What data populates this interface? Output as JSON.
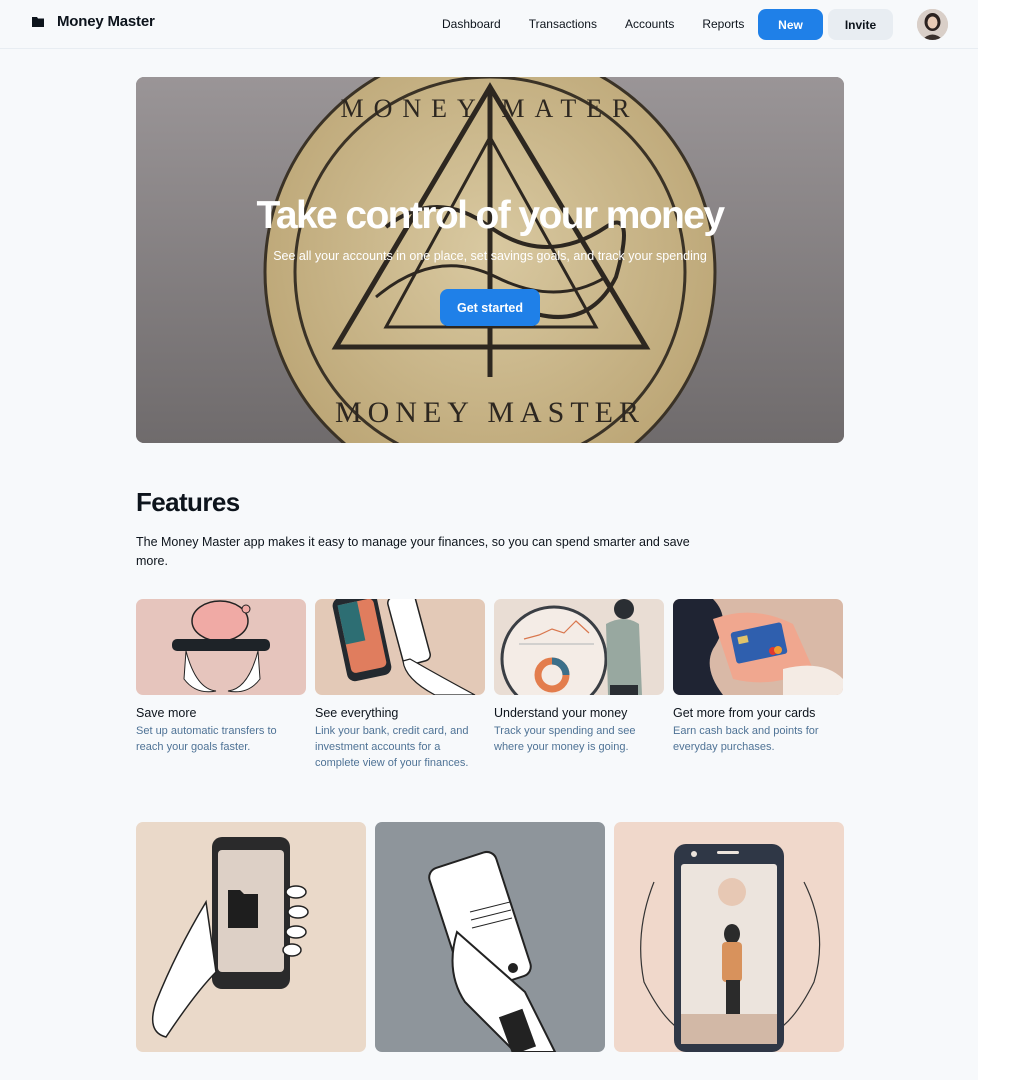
{
  "header": {
    "brand": "Money Master",
    "nav": [
      "Dashboard",
      "Transactions",
      "Accounts",
      "Reports"
    ],
    "new_label": "New",
    "invite_label": "Invite"
  },
  "hero": {
    "title": "Take control of your money",
    "subtitle": "See all your accounts in one place, set savings goals, and track your spending",
    "cta": "Get started",
    "coin_text_top": "MONEY MATER",
    "coin_text_bottom": "MONEY MASTER"
  },
  "features": {
    "title": "Features",
    "description": "The Money Master app makes it easy to manage your finances, so you can spend smarter and save more.",
    "cards": [
      {
        "title": "Save more",
        "desc": "Set up automatic transfers to reach your goals faster."
      },
      {
        "title": "See everything",
        "desc": "Link your bank, credit card, and investment accounts for a complete view of your finances."
      },
      {
        "title": "Understand your money",
        "desc": "Track your spending and see where your money is going."
      },
      {
        "title": "Get more from your cards",
        "desc": "Earn cash back and points for everyday purchases."
      }
    ]
  },
  "colors": {
    "accent": "#1f80e8",
    "muted_text": "#4f7396",
    "secondary_button": "#e8edf2"
  }
}
